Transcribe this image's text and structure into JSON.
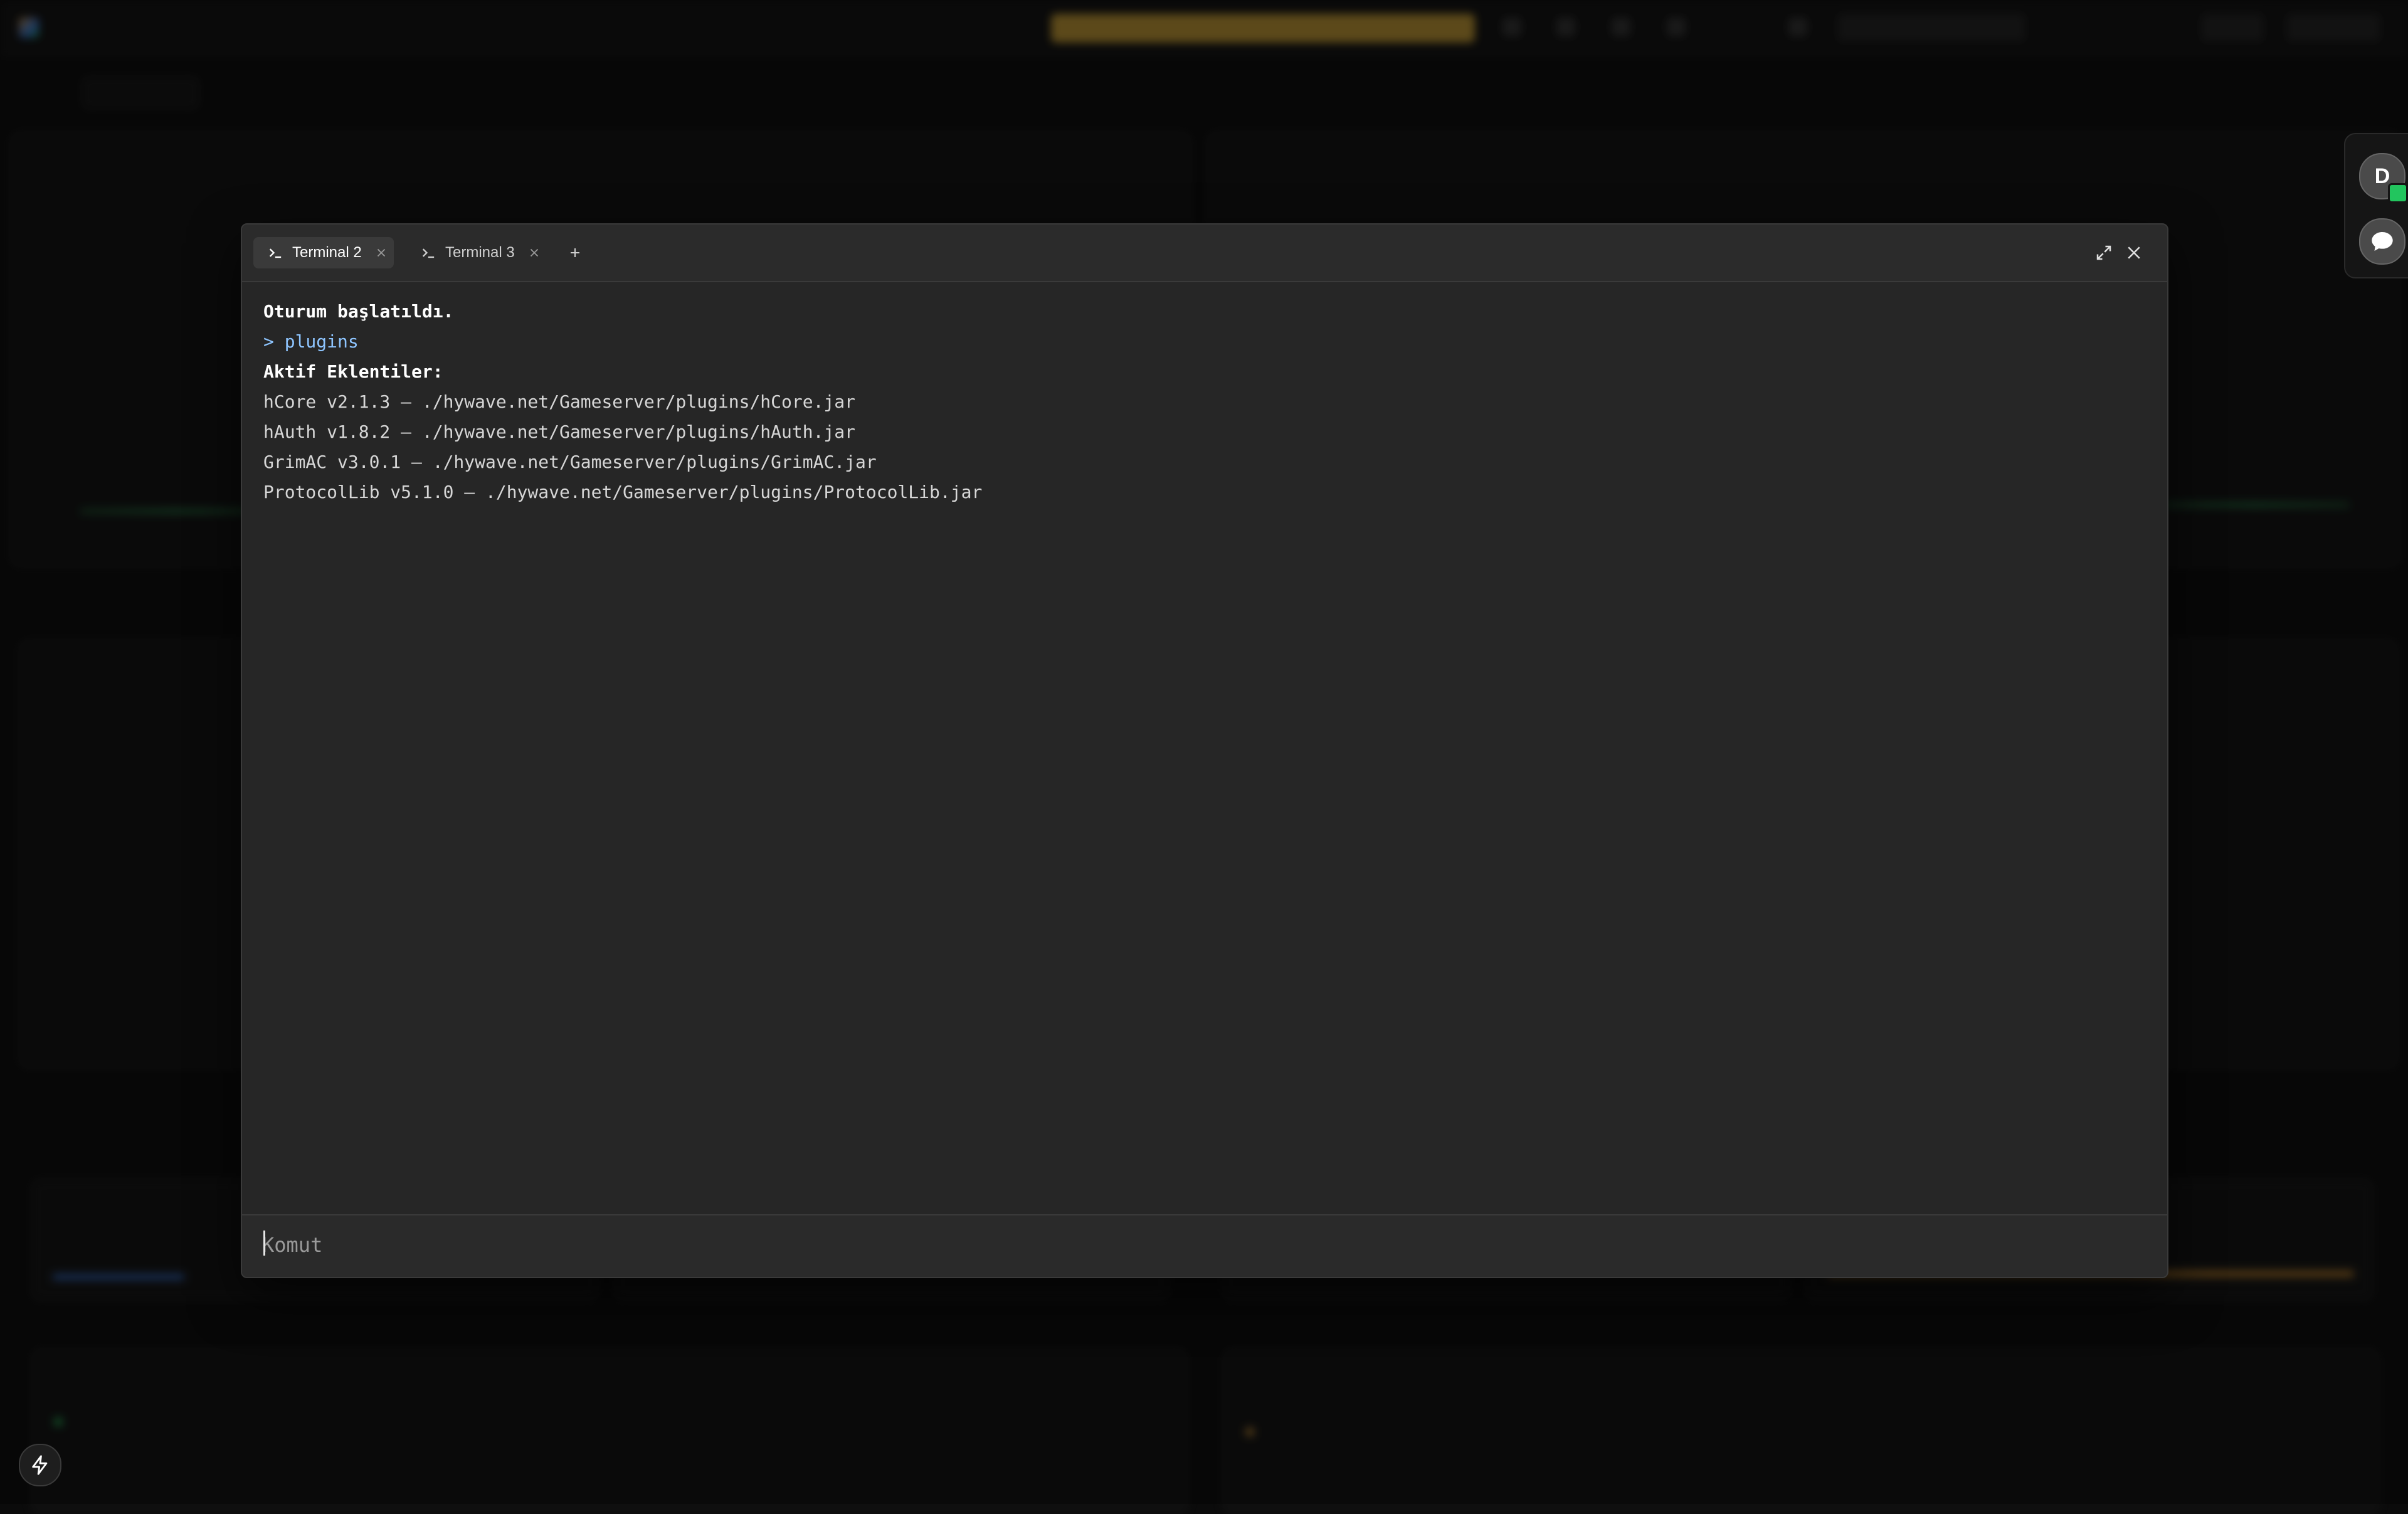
{
  "terminal": {
    "tabs": [
      {
        "label": "Terminal 2",
        "active": true
      },
      {
        "label": "Terminal 3",
        "active": false
      }
    ],
    "lines": [
      {
        "text": "Oturum başlatıldı.",
        "style": "bold"
      },
      {
        "text": "> plugins",
        "style": "cmd"
      },
      {
        "text": "Aktif Eklentiler:",
        "style": "bold"
      },
      {
        "text": "hCore v2.1.3 — ./hywave.net/Gameserver/plugins/hCore.jar",
        "style": "normal"
      },
      {
        "text": "hAuth v1.8.2 — ./hywave.net/Gameserver/plugins/hAuth.jar",
        "style": "normal"
      },
      {
        "text": "GrimAC v3.0.1 — ./hywave.net/Gameserver/plugins/GrimAC.jar",
        "style": "normal"
      },
      {
        "text": "ProtocolLib v5.1.0 — ./hywave.net/Gameserver/plugins/ProtocolLib.jar",
        "style": "normal"
      }
    ],
    "input_placeholder": "Komut",
    "input_value": ""
  },
  "rail": {
    "avatar_initial": "D"
  },
  "icons": {
    "tab_prompt": "terminal-prompt-icon",
    "tab_close": "close-icon",
    "add_tab": "plus-icon",
    "expand": "expand-icon",
    "close": "close-icon",
    "chat": "chat-bubble-icon",
    "quick": "lightning-icon"
  },
  "colors": {
    "terminal_bg": "#262626",
    "command_text": "#8ec5ff",
    "accent_green": "#22c55e"
  }
}
